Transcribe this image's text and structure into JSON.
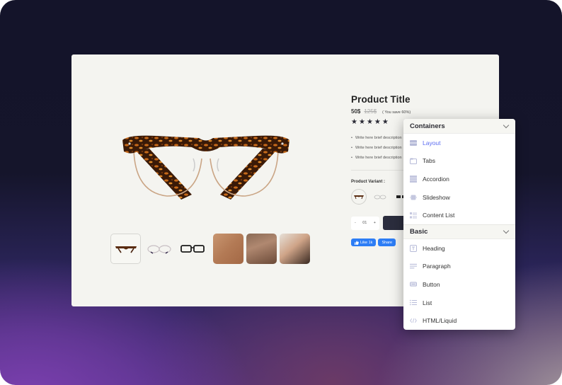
{
  "product": {
    "title": "Product Title",
    "price": "50$",
    "old_price": "125$",
    "save_text": "( You save 60%)",
    "rating": 5,
    "rating_max": 5,
    "star_glyph": "★",
    "bullets": [
      "Write here brief description",
      "Write here brief description",
      "Write here brief description"
    ],
    "variant_label": "Product Variant :",
    "variants": [
      "tortoise-glasses",
      "silver-glasses",
      "black-glasses"
    ],
    "selected_variant": 0,
    "quantity": "01",
    "qty_minus": "-",
    "qty_plus": "+",
    "like_label": "Like 1k",
    "share_label": "Share"
  },
  "gallery": {
    "thumbnails": [
      "tortoise-glasses",
      "silver-glasses",
      "black-glasses",
      "glasses-photo",
      "model-photo-1",
      "model-photo-2"
    ],
    "selected": 0
  },
  "panel": {
    "sections": [
      {
        "title": "Containers",
        "items": [
          {
            "label": "Layout",
            "icon": "layout-icon",
            "active": true
          },
          {
            "label": "Tabs",
            "icon": "tabs-icon"
          },
          {
            "label": "Accordion",
            "icon": "accordion-icon"
          },
          {
            "label": "Slideshow",
            "icon": "slideshow-icon"
          },
          {
            "label": "Content List",
            "icon": "content-list-icon"
          }
        ]
      },
      {
        "title": "Basic",
        "items": [
          {
            "label": "Heading",
            "icon": "heading-icon"
          },
          {
            "label": "Paragraph",
            "icon": "paragraph-icon"
          },
          {
            "label": "Button",
            "icon": "button-icon"
          },
          {
            "label": "List",
            "icon": "list-icon"
          },
          {
            "label": "HTML/Liquid",
            "icon": "code-icon"
          }
        ]
      }
    ]
  },
  "colors": {
    "accent": "#5b6cf0",
    "facebook": "#2d7df5",
    "cart_button": "#2b2d3d",
    "canvas": "#f4f4f0"
  }
}
